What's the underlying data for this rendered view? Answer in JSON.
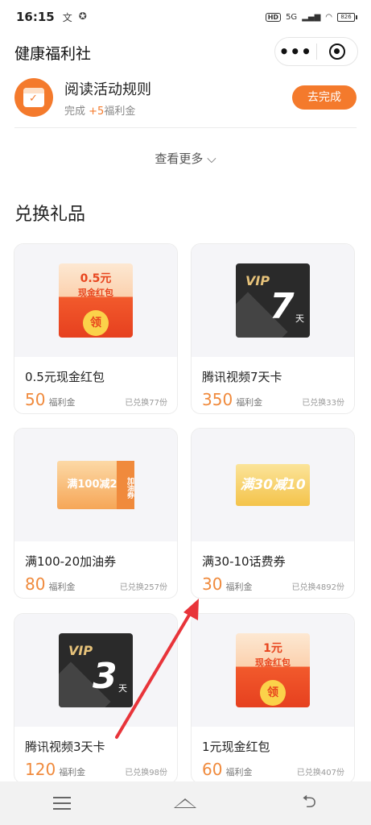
{
  "status_bar": {
    "time": "16:15",
    "network": "5G",
    "battery": "826"
  },
  "header": {
    "title": "健康福利社",
    "more_label": "•••"
  },
  "task": {
    "title": "阅读活动规则",
    "sub_prefix": "完成 ",
    "sub_plus": "+5",
    "sub_suffix": "福利金",
    "button": "去完成"
  },
  "see_more": "查看更多 ⌵",
  "section_title": "兑换礼品",
  "cards": [
    {
      "name": "0.5元现金红包",
      "price": "50",
      "unit": "福利金",
      "redeemed": "已兑换77份",
      "thumb_amount": "0.5元",
      "thumb_label": "现金红包",
      "thumb_coin": "领"
    },
    {
      "name": "腾讯视频7天卡",
      "price": "350",
      "unit": "福利金",
      "redeemed": "已兑换33份",
      "thumb_vip": "VIP",
      "thumb_days": "7",
      "thumb_tian": "天"
    },
    {
      "name": "满100-20加油券",
      "price": "80",
      "unit": "福利金",
      "redeemed": "已兑换257份",
      "thumb_text": "满100减20",
      "thumb_side": "加油券"
    },
    {
      "name": "满30-10话费券",
      "price": "30",
      "unit": "福利金",
      "redeemed": "已兑换4892份",
      "thumb_text": "满30减10"
    },
    {
      "name": "腾讯视频3天卡",
      "price": "120",
      "unit": "福利金",
      "redeemed": "已兑换98份",
      "thumb_vip": "VIP",
      "thumb_days": "3",
      "thumb_tian": "天"
    },
    {
      "name": "1元现金红包",
      "price": "60",
      "unit": "福利金",
      "redeemed": "已兑换407份",
      "thumb_amount": "1元",
      "thumb_label": "现金红包",
      "thumb_coin": "领"
    }
  ],
  "colors": {
    "accent": "#f47a2c",
    "price": "#f08a3c",
    "arrow": "#e8343a"
  }
}
